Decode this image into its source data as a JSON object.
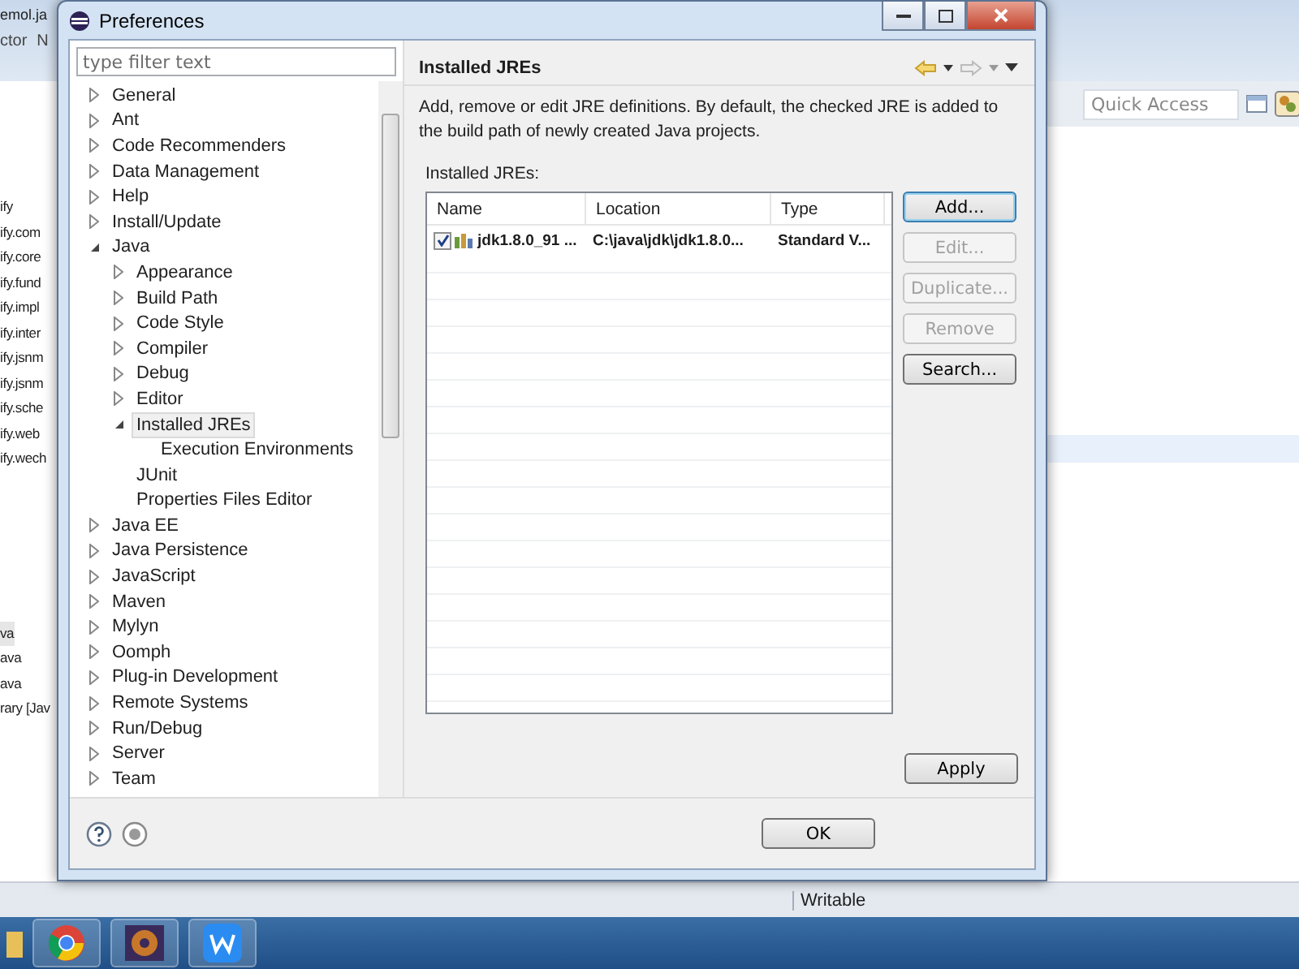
{
  "ide": {
    "tab": "emol.ja",
    "menu": [
      "ctor",
      "N"
    ],
    "packages": [
      "ify",
      "ify.com",
      "ify.core",
      "ify.fund",
      "ify.impl",
      "ify.inter",
      "ify.jsnm",
      "ify.jsnm",
      "ify.sche",
      "ify.web",
      "ify.wech"
    ],
    "files": [
      {
        "label": "va",
        "selected": true
      },
      {
        "label": "ava",
        "selected": false
      },
      {
        "label": "ava",
        "selected": false
      },
      {
        "label": "rary [Jav",
        "selected": false
      }
    ],
    "quick_access": {
      "placeholder": "Quick Access"
    },
    "status_bar": {
      "mode": "Writable"
    }
  },
  "dialog": {
    "title": "Preferences",
    "filter": {
      "placeholder": "type filter text"
    },
    "tree": [
      {
        "label": "General",
        "kind": "folder",
        "expanded": false,
        "selected": false
      },
      {
        "label": "Ant",
        "kind": "folder",
        "expanded": false,
        "selected": false
      },
      {
        "label": "Code Recommenders",
        "kind": "folder",
        "expanded": false,
        "selected": false
      },
      {
        "label": "Data Management",
        "kind": "folder",
        "expanded": false,
        "selected": false
      },
      {
        "label": "Help",
        "kind": "folder",
        "expanded": false,
        "selected": false
      },
      {
        "label": "Install/Update",
        "kind": "folder",
        "expanded": false,
        "selected": false
      },
      {
        "label": "Java",
        "kind": "folder",
        "expanded": true,
        "selected": false,
        "children": [
          {
            "label": "Appearance",
            "kind": "folder",
            "expanded": false,
            "selected": false
          },
          {
            "label": "Build Path",
            "kind": "folder",
            "expanded": false,
            "selected": false
          },
          {
            "label": "Code Style",
            "kind": "folder",
            "expanded": false,
            "selected": false
          },
          {
            "label": "Compiler",
            "kind": "folder",
            "expanded": false,
            "selected": false
          },
          {
            "label": "Debug",
            "kind": "folder",
            "expanded": false,
            "selected": false
          },
          {
            "label": "Editor",
            "kind": "folder",
            "expanded": false,
            "selected": false
          },
          {
            "label": "Installed JREs",
            "kind": "folder",
            "expanded": true,
            "selected": true,
            "children": [
              {
                "label": "Execution Environments",
                "kind": "leaf",
                "selected": false
              }
            ]
          },
          {
            "label": "JUnit",
            "kind": "leaf",
            "selected": false
          },
          {
            "label": "Properties Files Editor",
            "kind": "leaf",
            "selected": false
          }
        ]
      },
      {
        "label": "Java EE",
        "kind": "folder",
        "expanded": false,
        "selected": false
      },
      {
        "label": "Java Persistence",
        "kind": "folder",
        "expanded": false,
        "selected": false
      },
      {
        "label": "JavaScript",
        "kind": "folder",
        "expanded": false,
        "selected": false
      },
      {
        "label": "Maven",
        "kind": "folder",
        "expanded": false,
        "selected": false
      },
      {
        "label": "Mylyn",
        "kind": "folder",
        "expanded": false,
        "selected": false
      },
      {
        "label": "Oomph",
        "kind": "folder",
        "expanded": false,
        "selected": false
      },
      {
        "label": "Plug-in Development",
        "kind": "folder",
        "expanded": false,
        "selected": false
      },
      {
        "label": "Remote Systems",
        "kind": "folder",
        "expanded": false,
        "selected": false
      },
      {
        "label": "Run/Debug",
        "kind": "folder",
        "expanded": false,
        "selected": false
      },
      {
        "label": "Server",
        "kind": "folder",
        "expanded": false,
        "selected": false
      },
      {
        "label": "Team",
        "kind": "folder",
        "expanded": false,
        "selected": false
      }
    ],
    "page": {
      "title": "Installed JREs",
      "description": "Add, remove or edit JRE definitions. By default, the checked JRE is added to the build path of newly created Java projects.",
      "table_label": "Installed JREs:",
      "columns": [
        "Name",
        "Location",
        "Type"
      ],
      "rows": [
        {
          "checked": true,
          "name": "jdk1.8.0_91 ...",
          "location": "C:\\java\\jdk\\jdk1.8.0...",
          "type": "Standard V..."
        }
      ],
      "buttons": [
        {
          "label": "Add...",
          "disabled": false,
          "default": true
        },
        {
          "label": "Edit...",
          "disabled": true,
          "default": false
        },
        {
          "label": "Duplicate...",
          "disabled": true,
          "default": false
        },
        {
          "label": "Remove",
          "disabled": true,
          "default": false
        },
        {
          "label": "Search...",
          "disabled": false,
          "default": false
        }
      ]
    },
    "apply": "Apply",
    "ok": "OK"
  }
}
